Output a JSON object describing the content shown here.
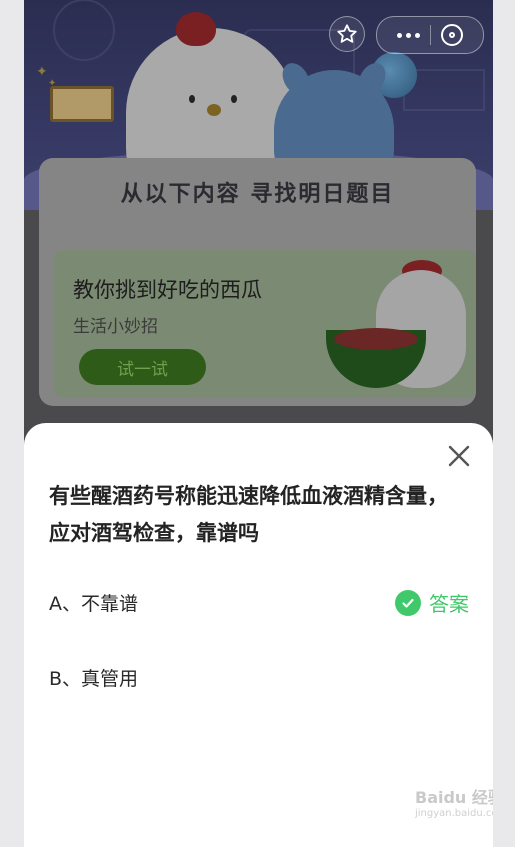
{
  "banner": {
    "heading": "从以下内容 寻找明日题目",
    "tip_title": "教你挑到好吃的西瓜",
    "tip_subtitle": "生活小妙招",
    "try_button": "试一试"
  },
  "top_bar": {
    "icons": [
      "star-icon",
      "more-dots-icon",
      "close-target-icon"
    ]
  },
  "quiz": {
    "question": "有些醒酒药号称能迅速降低血液酒精含量，应对酒驾检查，靠谱吗",
    "options": [
      {
        "label": "A、不靠谱",
        "is_answer": true
      },
      {
        "label": "B、真管用",
        "is_answer": false
      }
    ],
    "answer_label": "答案",
    "answer_color": "#3fc96a"
  },
  "watermark": {
    "brand": "Baidu 经验",
    "url": "jingyan.baidu.com"
  }
}
